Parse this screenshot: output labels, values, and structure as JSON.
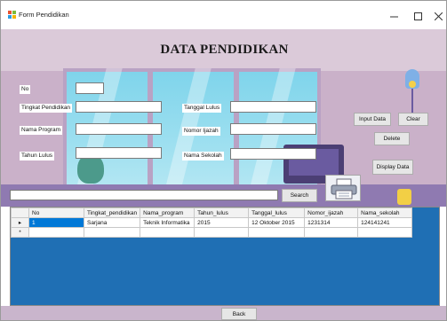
{
  "window": {
    "title": "Form Pendidikan"
  },
  "heading": "DATA PENDIDIKAN",
  "form": {
    "no_label": "No",
    "tingkat_label": "Tingkat Pendidikan",
    "nama_program_label": "Nama Program",
    "tahun_lulus_label": "Tahun Lulus",
    "tanggal_lulus_label": "Tanggal Lulus",
    "nomor_ijazah_label": "Nomor Ijazah",
    "nama_sekolah_label": "Nama Sekolah",
    "no_value": "",
    "tingkat_value": "",
    "nama_program_value": "",
    "tahun_lulus_value": "",
    "tanggal_lulus_value": "",
    "nomor_ijazah_value": "",
    "nama_sekolah_value": ""
  },
  "buttons": {
    "input": "Input Data",
    "clear": "Clear",
    "delete": "Delete",
    "display": "Display Data",
    "search": "Search",
    "back": "Back"
  },
  "search_value": "",
  "grid": {
    "columns": [
      "No",
      "Tingkat_pendidikan",
      "Nama_program",
      "Tahun_lulus",
      "Tanggal_lulus",
      "Nomor_ijazah",
      "Nama_sekolah"
    ],
    "rows": [
      {
        "marker": "▸",
        "cells": [
          "1",
          "Sarjana",
          "Teknik Informatika",
          "2015",
          "12 Oktober 2015",
          "1231314",
          "124141241"
        ]
      },
      {
        "marker": "*",
        "cells": [
          "",
          "",
          "",
          "",
          "",
          "",
          ""
        ]
      }
    ]
  },
  "colors": {
    "grid_bg": "#1f6fb4",
    "selection": "#0078d7",
    "wall": "#cab1c9"
  }
}
